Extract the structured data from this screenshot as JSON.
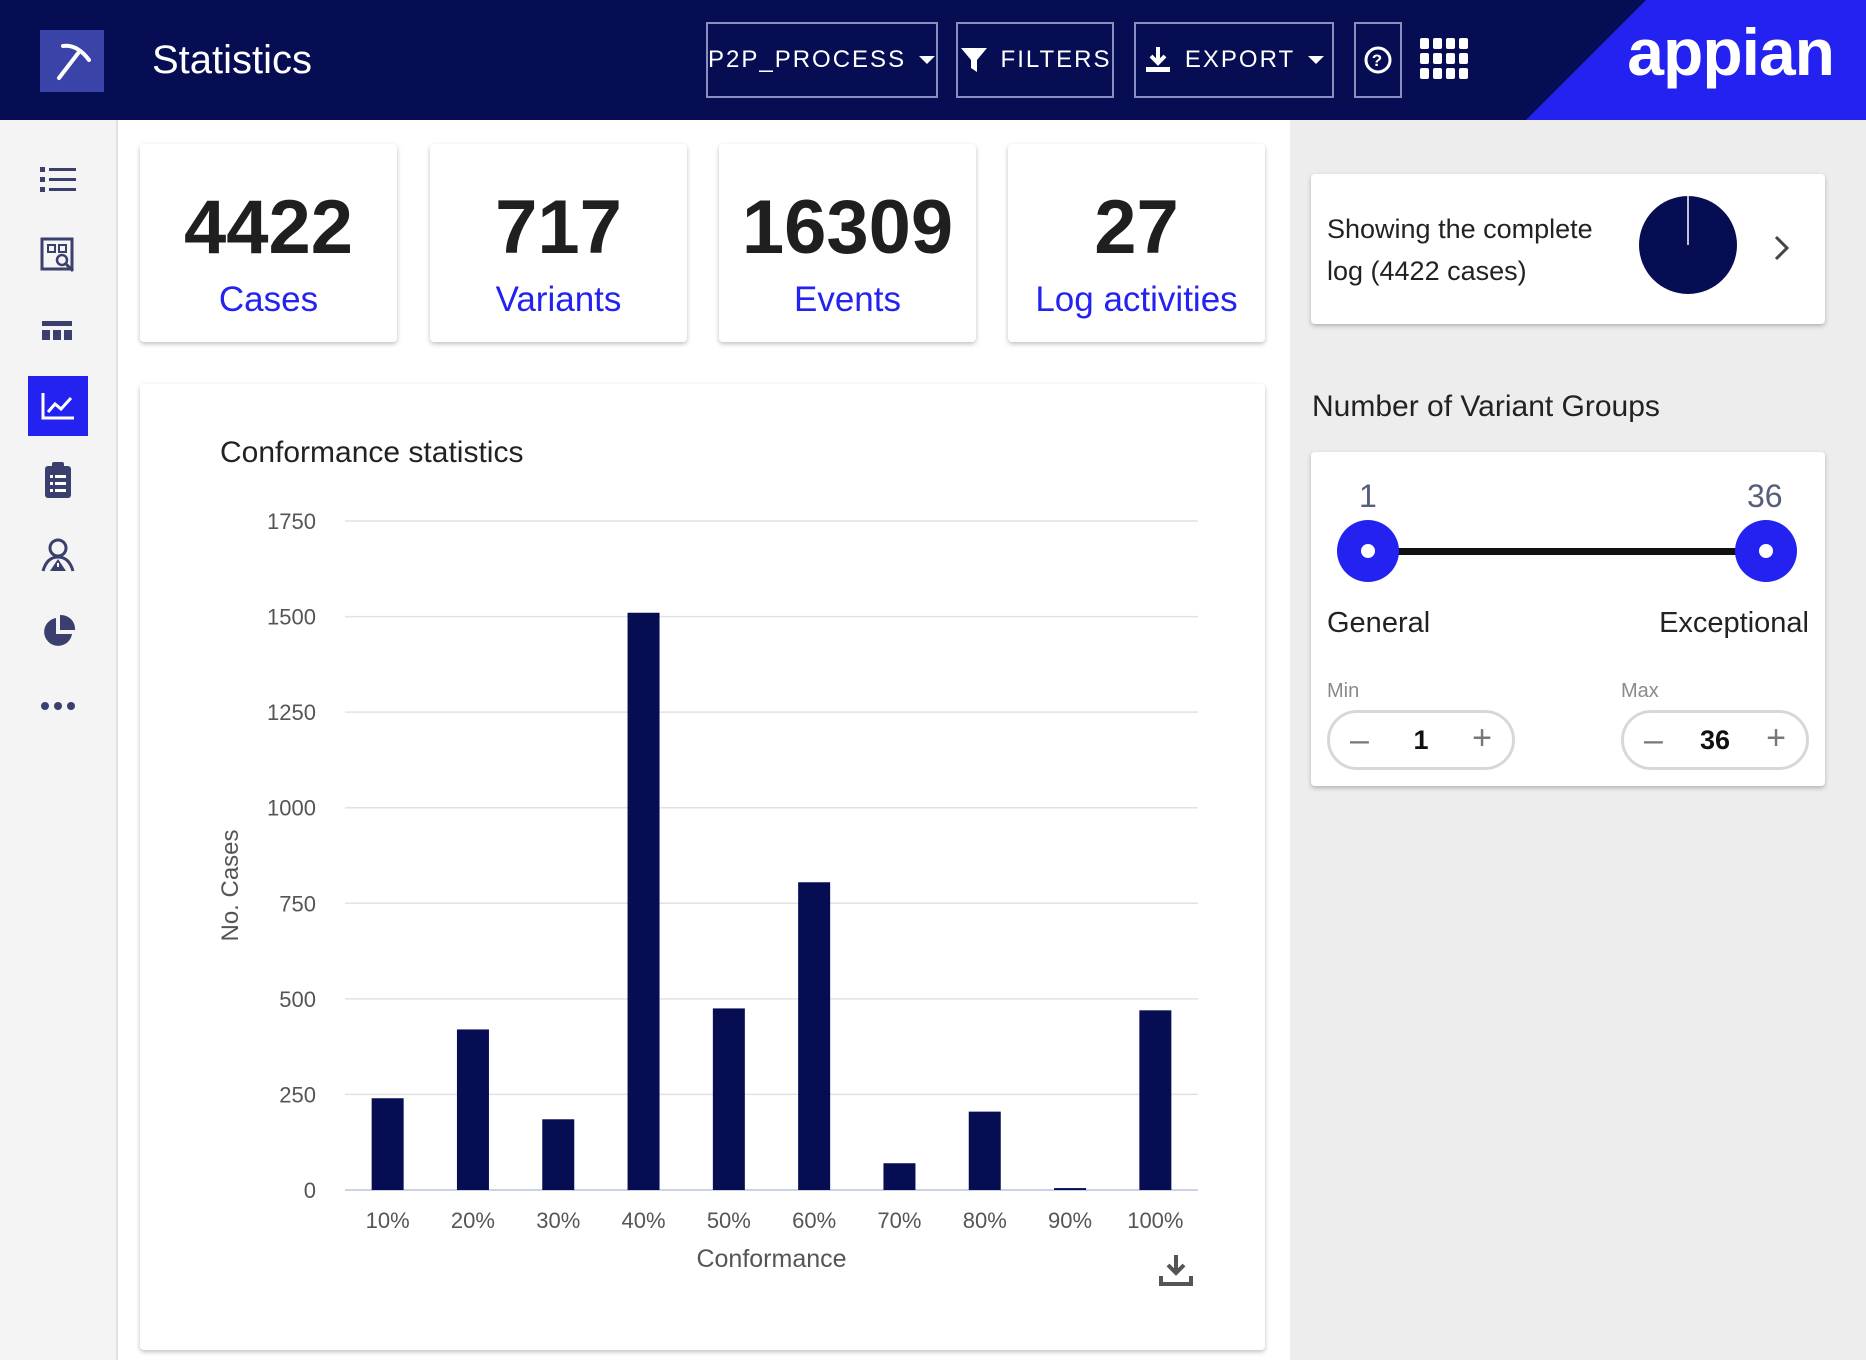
{
  "header": {
    "title": "Statistics",
    "process_select": "P2P_PROCESS",
    "filters_label": "FILTERS",
    "export_label": "EXPORT",
    "brand": "appian",
    "colors": {
      "navy": "#060d53",
      "accent": "#2322f0"
    }
  },
  "sidebar": {
    "items": [
      {
        "icon": "list-icon"
      },
      {
        "icon": "process-map-icon"
      },
      {
        "icon": "variants-icon"
      },
      {
        "icon": "statistics-chart-icon",
        "active": true
      },
      {
        "icon": "clipboard-icon"
      },
      {
        "icon": "alert-person-icon"
      },
      {
        "icon": "pie-chart-icon"
      },
      {
        "icon": "more-icon"
      }
    ]
  },
  "stats": [
    {
      "value": "4422",
      "label": "Cases"
    },
    {
      "value": "717",
      "label": "Variants"
    },
    {
      "value": "16309",
      "label": "Events"
    },
    {
      "value": "27",
      "label": "Log activities"
    }
  ],
  "chart_data": {
    "type": "bar",
    "title": "Conformance statistics",
    "xlabel": "Conformance",
    "ylabel": "No. Cases",
    "categories": [
      "10%",
      "20%",
      "30%",
      "40%",
      "50%",
      "60%",
      "70%",
      "80%",
      "90%",
      "100%"
    ],
    "values": [
      240,
      420,
      185,
      1510,
      475,
      805,
      70,
      205,
      5,
      470
    ],
    "ylim": [
      0,
      1750
    ],
    "yticks": [
      "0",
      "250",
      "500",
      "750",
      "1000",
      "1250",
      "1500",
      "1750"
    ],
    "grid": true,
    "bar_color": "#060d53"
  },
  "log_summary": {
    "line1": "Showing the complete",
    "line2": "log (4422 cases)",
    "fraction_shown": 1.0
  },
  "variant_groups": {
    "title": "Number of Variant Groups",
    "min_value": "1",
    "max_value": "36",
    "left_label": "General",
    "right_label": "Exceptional",
    "min_label": "Min",
    "max_label": "Max",
    "min_stepper": "1",
    "max_stepper": "36",
    "minus_symbol": "–",
    "plus_symbol": "+"
  }
}
